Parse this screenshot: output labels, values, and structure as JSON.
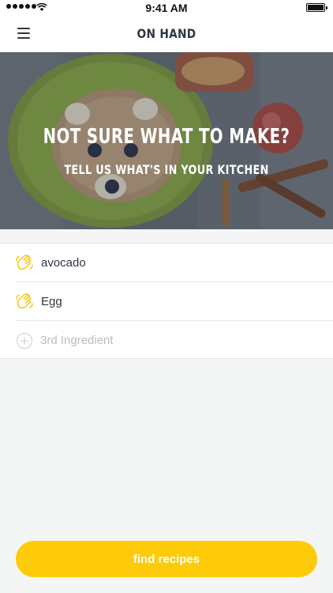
{
  "status_bar": {
    "time": "9:41 AM"
  },
  "nav": {
    "title": "ON HAND",
    "menu_icon": "hamburger-menu-icon"
  },
  "hero": {
    "title": "NOT SURE WHAT TO MAKE?",
    "subtitle": "TELL US WHAT'S IN YOUR KITCHEN"
  },
  "ingredients": {
    "items": [
      {
        "value": "avocado",
        "icon": "hand-wave-icon"
      },
      {
        "value": "Egg",
        "icon": "hand-wave-icon"
      }
    ],
    "add_placeholder": "3rd Ingredient",
    "add_icon": "plus-circle-icon"
  },
  "actions": {
    "find_label": "find recipes"
  },
  "colors": {
    "accent": "#fecb0a",
    "text": "#2f3742",
    "background": "#f4f5f5"
  }
}
